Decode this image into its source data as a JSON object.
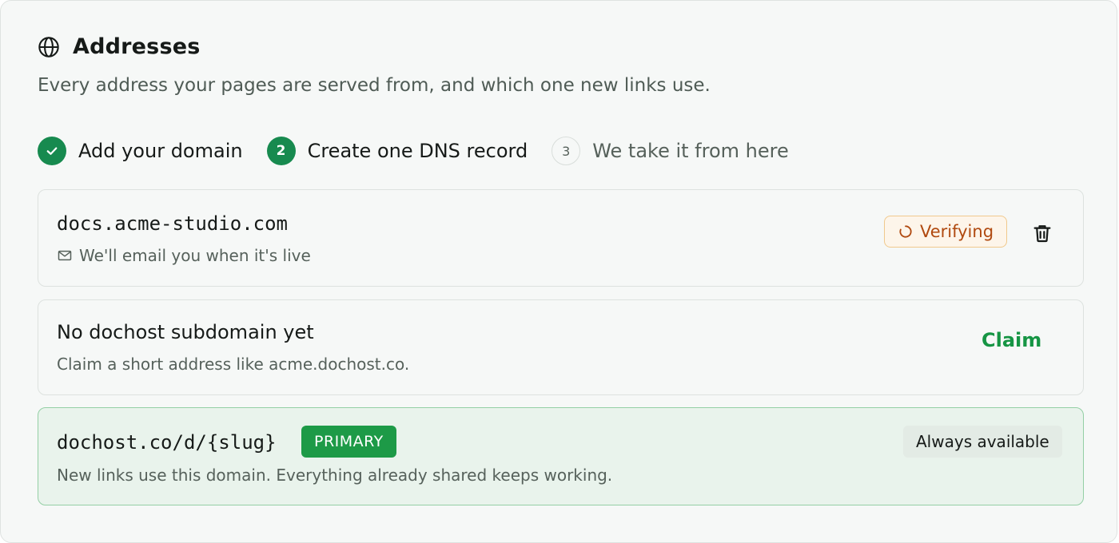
{
  "section": {
    "title": "Addresses",
    "subtitle": "Every address your pages are served from, and which one new links use.",
    "icon": "globe-icon"
  },
  "steps": [
    {
      "number": "1",
      "label": "Add your domain",
      "status": "done"
    },
    {
      "number": "2",
      "label": "Create one DNS record",
      "status": "active"
    },
    {
      "number": "3",
      "label": "We take it from here",
      "status": "pending"
    }
  ],
  "custom_domain": {
    "domain": "docs.acme-studio.com",
    "note": "We'll email you when it's live",
    "status_label": "Verifying",
    "status_color": "#b0490f"
  },
  "subdomain": {
    "title": "No dochost subdomain yet",
    "description": "Claim a short address like acme.dochost.co.",
    "action_label": "Claim"
  },
  "primary_domain": {
    "domain": "dochost.co/d/{slug}",
    "badge": "PRIMARY",
    "description": "New links use this domain. Everything already shared keeps working.",
    "availability": "Always available"
  },
  "colors": {
    "accent": "#178a4f",
    "primary_badge": "#1d9a47",
    "claim": "#169544"
  }
}
